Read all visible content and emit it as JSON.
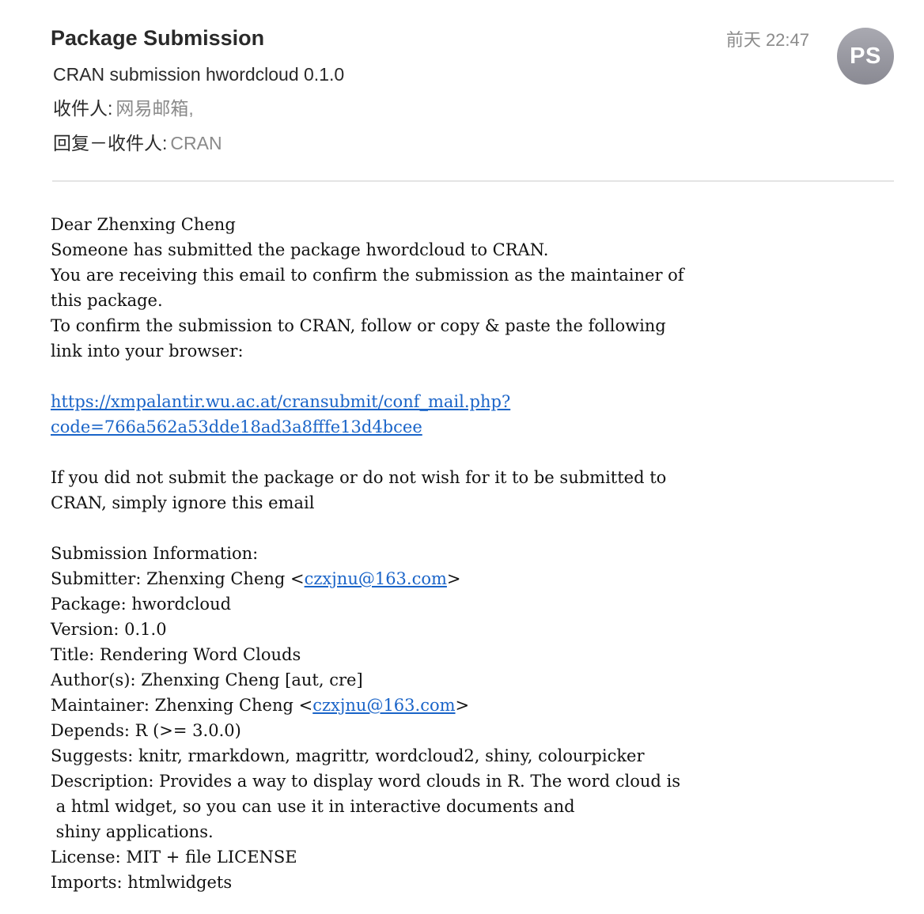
{
  "header": {
    "sender_name": "Package Submission",
    "subject": "CRAN submission hwordcloud 0.1.0",
    "to_label": "收件人:",
    "to_value": "网易邮箱,",
    "reply_to_label": "回复－收件人:",
    "reply_to_value": "CRAN",
    "date": "前天 22:47",
    "avatar_initials": "PS"
  },
  "body": {
    "greeting": "Dear Zhenxing Cheng",
    "line1": "Someone has submitted the package hwordcloud to CRAN.",
    "line2": "You are receiving this email to confirm the submission as the maintainer of",
    "line3": "this package.",
    "line4": "To confirm the submission to CRAN, follow or copy & paste the following",
    "line5": "link into your browser:",
    "link_line1": "https://xmpalantir.wu.ac.at/cransubmit/conf_mail.php?",
    "link_line2": "code=766a562a53dde18ad3a8fffe13d4bcee",
    "ignore_line1": "If you did not submit the package or do not wish for it to be submitted to",
    "ignore_line2": "CRAN, simply ignore this email",
    "info_header": "Submission Information:",
    "submitter_prefix": "Submitter: Zhenxing Cheng <",
    "submitter_email": "czxjnu@163.com",
    "email_suffix": ">",
    "package": "Package: hwordcloud",
    "version": "Version: 0.1.0",
    "title": "Title: Rendering Word Clouds",
    "authors": "Author(s): Zhenxing Cheng [aut, cre]",
    "maintainer_prefix": "Maintainer: Zhenxing Cheng <",
    "maintainer_email": "czxjnu@163.com",
    "depends": "Depends: R (>= 3.0.0)",
    "suggests": "Suggests: knitr, rmarkdown, magrittr, wordcloud2, shiny, colourpicker",
    "description1": "Description: Provides a way to display word clouds in R. The word cloud is",
    "description2": " a html widget, so you can use it in interactive documents and",
    "description3": " shiny applications.",
    "license": "License: MIT + file LICENSE",
    "imports": "Imports: htmlwidgets"
  },
  "colors": {
    "link": "#1a64c8",
    "muted_text": "#8a8a8a",
    "avatar_bg": "#9a9aa2"
  }
}
